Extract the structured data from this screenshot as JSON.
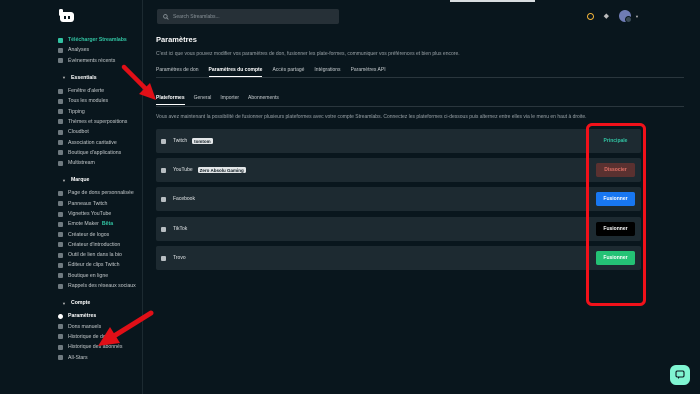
{
  "sidebar": {
    "top_items": [
      {
        "label": "Télécharger Streamlabs",
        "icon": "download-icon",
        "active": true
      },
      {
        "label": "Analyses",
        "icon": "chart-icon"
      },
      {
        "label": "Événements récents",
        "icon": "list-icon"
      }
    ],
    "sections": [
      {
        "title": "Essentials",
        "items": [
          {
            "label": "Fenêtre d'alerte",
            "icon": "alert-box-icon"
          },
          {
            "label": "Tous les modules",
            "icon": "grid-icon"
          },
          {
            "label": "Tipping",
            "icon": "tip-icon"
          },
          {
            "label": "Thèmes et superpositions",
            "icon": "themes-icon"
          },
          {
            "label": "Cloudbot",
            "icon": "bot-icon"
          },
          {
            "label": "Association caritative",
            "icon": "charity-icon"
          },
          {
            "label": "Boutique d'applications",
            "icon": "store-icon"
          },
          {
            "label": "Multistream",
            "icon": "multistream-icon"
          }
        ]
      },
      {
        "title": "Marque",
        "items": [
          {
            "label": "Page de dons personnalisée",
            "icon": "page-icon"
          },
          {
            "label": "Panneaux Twitch",
            "icon": "panel-icon"
          },
          {
            "label": "Vignettes YouTube",
            "icon": "thumbnail-icon"
          },
          {
            "label": "Emote Maker",
            "icon": "emote-icon",
            "badge": "Bêta"
          },
          {
            "label": "Créateur de logos",
            "icon": "logo-maker-icon"
          },
          {
            "label": "Créateur d'introduction",
            "icon": "intro-icon"
          },
          {
            "label": "Outil de lien dans la bio",
            "icon": "link-icon"
          },
          {
            "label": "Éditeur de clips Twitch",
            "icon": "clip-icon"
          },
          {
            "label": "Boutique en ligne",
            "icon": "shop-icon"
          },
          {
            "label": "Rappels des réseaux sociaux",
            "icon": "social-icon"
          }
        ]
      },
      {
        "title": "Compte",
        "items": [
          {
            "label": "Paramètres",
            "icon": "gear-icon",
            "bold": true
          },
          {
            "label": "Dons manuels",
            "icon": "manual-donation-icon"
          },
          {
            "label": "Historique de dons",
            "icon": "history-icon"
          },
          {
            "label": "Historique des abonnés",
            "icon": "subscribers-icon"
          },
          {
            "label": "All-Stars",
            "icon": "star-icon"
          }
        ]
      }
    ]
  },
  "topbar": {
    "search_placeholder": "Search Streamlabs..."
  },
  "page": {
    "title": "Paramètres",
    "description": "C'est ici que vous pouvez modifier vos paramètres de don, fusionner les plate-formes, communiquer vos préférences et bien plus encore.",
    "tabs": [
      "Paramètres de don",
      "Paramètres du compte",
      "Accès partagé",
      "Intégrations",
      "Paramètres API"
    ],
    "active_tab": 1,
    "subtabs": [
      "Plateformes",
      "General",
      "Importer",
      "Abonnements"
    ],
    "active_subtab": 0,
    "info": "Vous avez maintenant la possibilité de fusionner plusieurs plateformes avec votre compte Streamlabs. Connectez les plateformes ci-dessous puis alternez entre elles via le menu en haut à droite."
  },
  "platforms": [
    {
      "name": "Twitch",
      "icon": "twitch-icon",
      "tag": "tomtom",
      "action": "Principale",
      "style": "primary-label"
    },
    {
      "name": "YouTube",
      "icon": "youtube-icon",
      "tag": "Zero Absolu Gaming",
      "action": "Dissocier",
      "style": "unlink"
    },
    {
      "name": "Facebook",
      "icon": "facebook-icon",
      "tag": "",
      "action": "Fusionner",
      "style": "facebook"
    },
    {
      "name": "TikTok",
      "icon": "tiktok-icon",
      "tag": "",
      "action": "Fusionner",
      "style": "tiktok"
    },
    {
      "name": "Trovo",
      "icon": "trovo-icon",
      "tag": "",
      "action": "Fusionner",
      "style": "trovo"
    }
  ],
  "colors": {
    "accent": "#31c3a2",
    "annotation_red": "#f2111a",
    "facebook_blue": "#1877f2",
    "trovo_green": "#24c275"
  }
}
